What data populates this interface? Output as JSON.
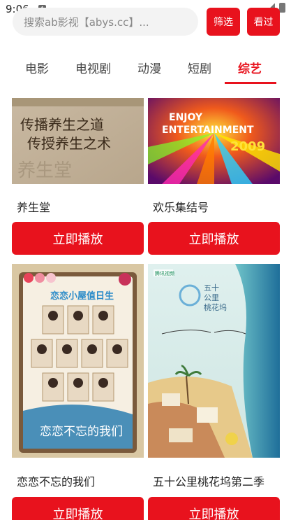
{
  "status": {
    "time": "9:06",
    "badge": "A"
  },
  "header": {
    "search_placeholder": "搜索ab影视【abys.cc】...",
    "filter_label": "筛选",
    "history_label": "看过"
  },
  "tabs": [
    {
      "label": "电影"
    },
    {
      "label": "电视剧"
    },
    {
      "label": "动漫"
    },
    {
      "label": "短剧"
    },
    {
      "label": "综艺",
      "active": true
    }
  ],
  "cards": [
    {
      "title": "养生堂",
      "play_label": "立即播放",
      "poster_text": {
        "line1": "传播养生之道",
        "line2": "传授养生之术",
        "watermark": "养生堂"
      }
    },
    {
      "title": "欢乐集结号",
      "play_label": "立即播放",
      "poster_text": {
        "enjoy": "ENJOY",
        "entertainment": "ENTERTAINMENT",
        "year": "2009"
      }
    },
    {
      "title": "恋恋不忘的我们",
      "play_label": "立即播放",
      "poster_text": {
        "top": "恋恋小屋值日生",
        "bottom": "恋恋不忘的我们"
      }
    },
    {
      "title": "五十公里桃花坞第二季",
      "play_label": "立即播放",
      "poster_text": {
        "brand": "腾讯视频",
        "logo_line1": "五十",
        "logo_line2": "公里",
        "logo_line3": "桃花坞"
      }
    }
  ]
}
